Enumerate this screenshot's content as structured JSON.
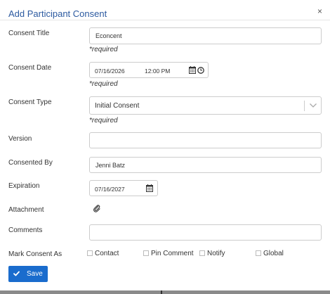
{
  "modal": {
    "title": "Add Participant Consent",
    "close": "×"
  },
  "consent_title": {
    "label": "Consent Title",
    "value": "Econcent",
    "required": "*required"
  },
  "consent_date": {
    "label": "Consent Date",
    "date": "07/16/2026",
    "time": "12:00 PM",
    "required": "*required"
  },
  "consent_type": {
    "label": "Consent Type",
    "value": "Initial Consent",
    "required": "*required"
  },
  "version": {
    "label": "Version",
    "value": ""
  },
  "consented_by": {
    "label": "Consented By",
    "value": "Jenni Batz"
  },
  "expiration": {
    "label": "Expiration",
    "date": "07/16/2027"
  },
  "attachment": {
    "label": "Attachment"
  },
  "comments": {
    "label": "Comments",
    "value": ""
  },
  "mark_consent": {
    "label": "Mark Consent As",
    "options": [
      {
        "label": "Contact",
        "checked": false
      },
      {
        "label": "Pin Comment",
        "checked": false
      },
      {
        "label": "Notify",
        "checked": false
      },
      {
        "label": "Global",
        "checked": false
      }
    ]
  },
  "save": {
    "label": "Save"
  },
  "colors": {
    "accent": "#1a6ccd",
    "title": "#2c5aa0",
    "border": "#cccccc"
  },
  "icons": [
    "close-icon",
    "calendar-icon",
    "clock-icon",
    "chevron-down-icon",
    "paperclip-icon",
    "checkmark-icon"
  ]
}
